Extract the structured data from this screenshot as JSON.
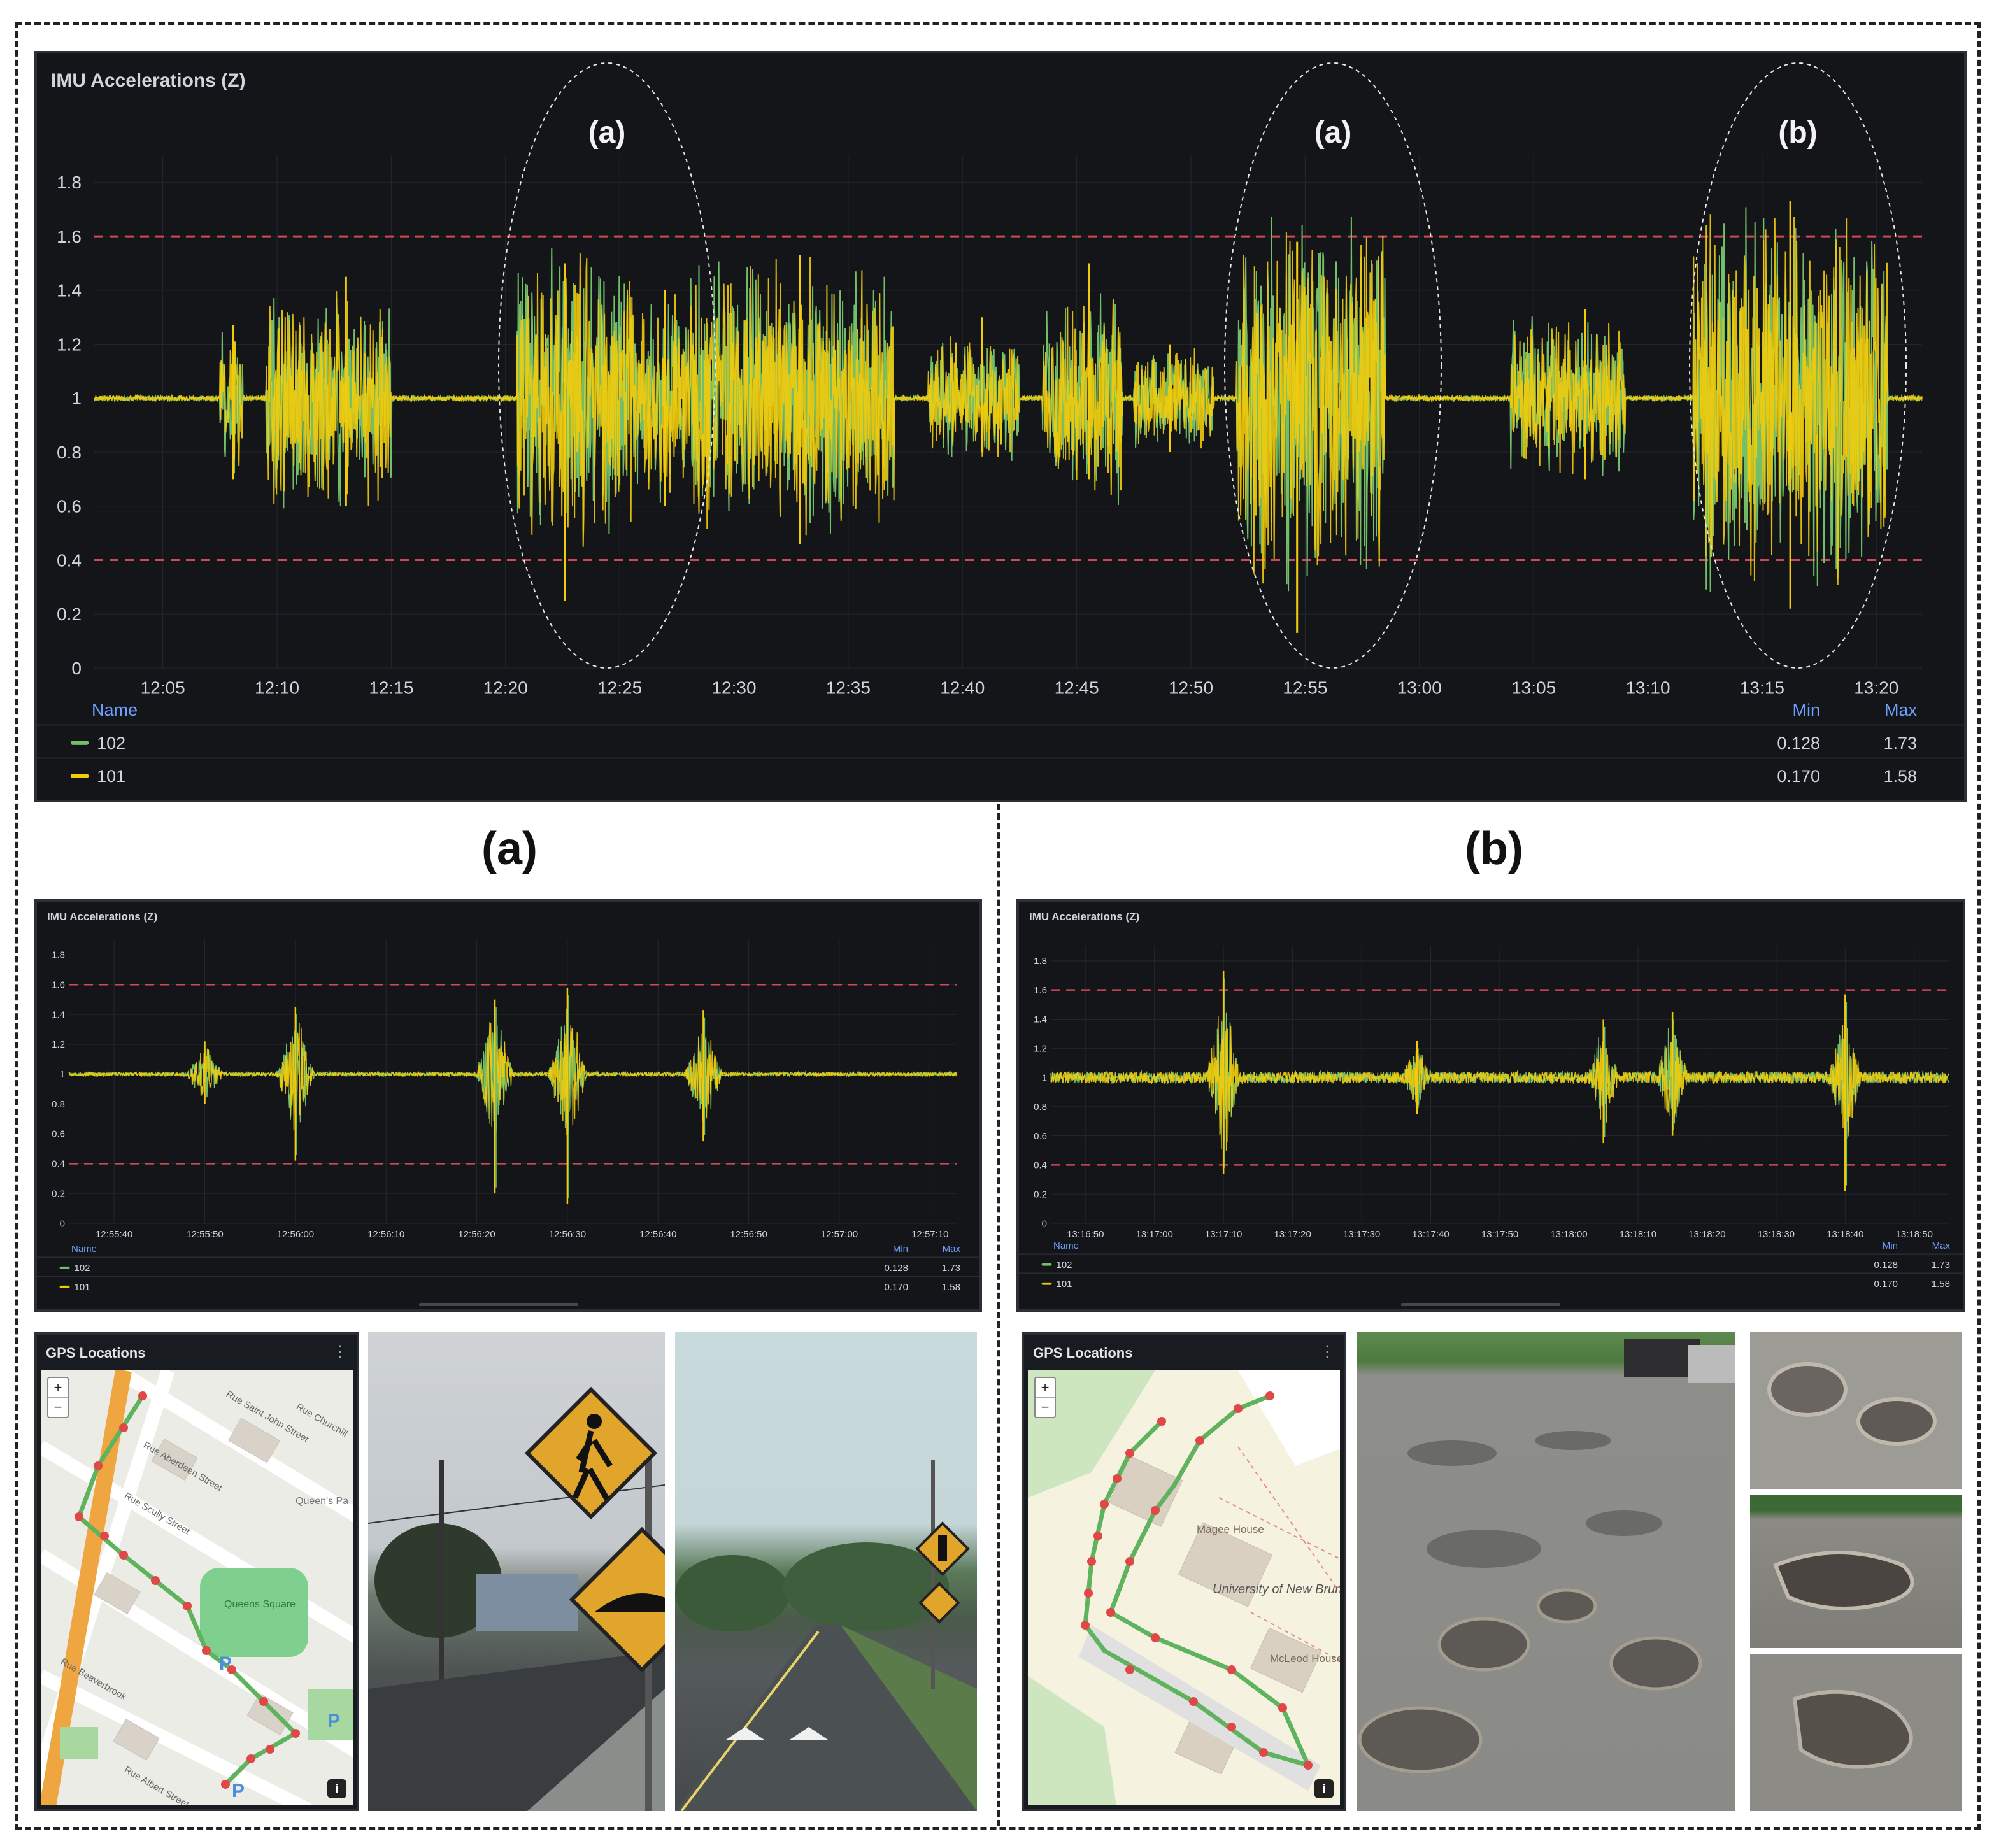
{
  "colors": {
    "panel_bg": "#141519",
    "series_102": "#73bf69",
    "series_101": "#f2cc0c",
    "threshold": "#d04a55",
    "axis_text": "#d0d4dc",
    "legend_header": "#6e9fff"
  },
  "top_chart": {
    "title": "IMU Accelerations (Z)",
    "y_ticks": [
      "1.8",
      "1.6",
      "1.4",
      "1.2",
      "1",
      "0.8",
      "0.6",
      "0.4",
      "0.2",
      "0"
    ],
    "x_ticks": [
      "12:05",
      "12:10",
      "12:15",
      "12:20",
      "12:25",
      "12:30",
      "12:35",
      "12:40",
      "12:45",
      "12:50",
      "12:55",
      "13:00",
      "13:05",
      "13:10",
      "13:15",
      "13:20"
    ],
    "annotations": [
      "(a)",
      "(a)",
      "(b)"
    ],
    "legend": {
      "name_header": "Name",
      "min_header": "Min",
      "max_header": "Max",
      "rows": [
        {
          "name": "102",
          "min": "0.128",
          "max": "1.73",
          "color": "#73bf69"
        },
        {
          "name": "101",
          "min": "0.170",
          "max": "1.58",
          "color": "#f2cc0c"
        }
      ]
    }
  },
  "section_a": {
    "label": "(a)",
    "chart": {
      "title": "IMU Accelerations (Z)",
      "y_ticks": [
        "1.8",
        "1.6",
        "1.4",
        "1.2",
        "1",
        "0.8",
        "0.6",
        "0.4",
        "0.2",
        "0"
      ],
      "x_ticks": [
        "12:55:40",
        "12:55:50",
        "12:56:00",
        "12:56:10",
        "12:56:20",
        "12:56:30",
        "12:56:40",
        "12:56:50",
        "12:57:00",
        "12:57:10"
      ],
      "legend": {
        "name_header": "Name",
        "min_header": "Min",
        "max_header": "Max",
        "rows": [
          {
            "name": "102",
            "min": "0.128",
            "max": "1.73"
          },
          {
            "name": "101",
            "min": "0.170",
            "max": "1.58"
          }
        ]
      }
    },
    "gps": {
      "title": "GPS Locations",
      "zoom_in": "+",
      "zoom_out": "−",
      "info": "i",
      "map_labels": [
        "Rue Aberdeen Street",
        "Rue Scully Street",
        "Queens Square",
        "Queen's Pa",
        "Rue Beaverbrook",
        "Rue Albert Street",
        "Rue Saint John Street",
        "Rue Churchill"
      ]
    },
    "photos": [
      "pedestrian-crossing-and-speed-bump-signs-photo",
      "speed-bump-road-photo"
    ]
  },
  "section_b": {
    "label": "(b)",
    "chart": {
      "title": "IMU Accelerations (Z)",
      "y_ticks": [
        "1.8",
        "1.6",
        "1.4",
        "1.2",
        "1",
        "0.8",
        "0.6",
        "0.4",
        "0.2",
        "0"
      ],
      "x_ticks": [
        "13:16:50",
        "13:17:00",
        "13:17:10",
        "13:17:20",
        "13:17:30",
        "13:17:40",
        "13:17:50",
        "13:18:00",
        "13:18:10",
        "13:18:20",
        "13:18:30",
        "13:18:40",
        "13:18:50"
      ],
      "legend": {
        "name_header": "Name",
        "min_header": "Min",
        "max_header": "Max",
        "rows": [
          {
            "name": "102",
            "min": "0.128",
            "max": "1.73"
          },
          {
            "name": "101",
            "min": "0.170",
            "max": "1.58"
          }
        ]
      }
    },
    "gps": {
      "title": "GPS Locations",
      "zoom_in": "+",
      "zoom_out": "−",
      "info": "i",
      "map_labels": [
        "Magee House",
        "University of New Brunswick",
        "McLeod House"
      ]
    },
    "photos": [
      "potholed-parking-lot-photo",
      "pothole-closeup-photo-1",
      "pothole-closeup-photo-2",
      "pothole-closeup-photo-3"
    ]
  },
  "chart_data": [
    {
      "type": "line",
      "title": "IMU Accelerations (Z)",
      "x_range": [
        "12:02",
        "13:22"
      ],
      "ylim": [
        0,
        1.9
      ],
      "thresholds": [
        0.4,
        1.6
      ],
      "series": [
        {
          "name": "102",
          "min": 0.128,
          "max": 1.73
        },
        {
          "name": "101",
          "min": 0.17,
          "max": 1.58
        }
      ],
      "activity_bursts": [
        {
          "from": "12:07:30",
          "to": "12:08:30",
          "lo": 0.7,
          "hi": 1.27
        },
        {
          "from": "12:09:30",
          "to": "12:15:00",
          "lo": 0.6,
          "hi": 1.45
        },
        {
          "from": "12:20:30",
          "to": "12:25:30",
          "lo": 0.25,
          "hi": 1.5
        },
        {
          "from": "12:25:30",
          "to": "12:28:00",
          "lo": 0.6,
          "hi": 1.4
        },
        {
          "from": "12:28:00",
          "to": "12:37:00",
          "lo": 0.46,
          "hi": 1.53
        },
        {
          "from": "12:38:30",
          "to": "12:42:30",
          "lo": 0.8,
          "hi": 1.3
        },
        {
          "from": "12:43:30",
          "to": "12:47:00",
          "lo": 0.7,
          "hi": 1.5
        },
        {
          "from": "12:47:30",
          "to": "12:51:00",
          "lo": 0.8,
          "hi": 1.2
        },
        {
          "from": "12:52:00",
          "to": "12:58:30",
          "lo": 0.13,
          "hi": 1.58
        },
        {
          "from": "13:04:00",
          "to": "13:09:00",
          "lo": 0.7,
          "hi": 1.33
        },
        {
          "from": "13:12:00",
          "to": "13:20:30",
          "lo": 0.22,
          "hi": 1.73
        }
      ]
    },
    {
      "type": "line",
      "title": "IMU Accelerations (Z)",
      "x_range": [
        "12:55:35",
        "12:57:13"
      ],
      "ylim": [
        0,
        1.9
      ],
      "thresholds": [
        0.4,
        1.6
      ],
      "spikes": [
        {
          "t": "12:55:50",
          "lo": 0.8,
          "hi": 1.22
        },
        {
          "t": "12:56:00",
          "lo": 0.42,
          "hi": 1.45
        },
        {
          "t": "12:56:22",
          "lo": 0.2,
          "hi": 1.5
        },
        {
          "t": "12:56:30",
          "lo": 0.13,
          "hi": 1.58
        },
        {
          "t": "12:56:45",
          "lo": 0.55,
          "hi": 1.43
        }
      ]
    },
    {
      "type": "line",
      "title": "IMU Accelerations (Z)",
      "x_range": [
        "13:16:45",
        "13:18:55"
      ],
      "ylim": [
        0,
        1.9
      ],
      "thresholds": [
        0.4,
        1.6
      ],
      "spikes": [
        {
          "t": "13:17:10",
          "lo": 0.34,
          "hi": 1.73
        },
        {
          "t": "13:17:38",
          "lo": 0.75,
          "hi": 1.25
        },
        {
          "t": "13:18:05",
          "lo": 0.55,
          "hi": 1.4
        },
        {
          "t": "13:18:15",
          "lo": 0.6,
          "hi": 1.45
        },
        {
          "t": "13:18:40",
          "lo": 0.22,
          "hi": 1.57
        }
      ]
    }
  ]
}
